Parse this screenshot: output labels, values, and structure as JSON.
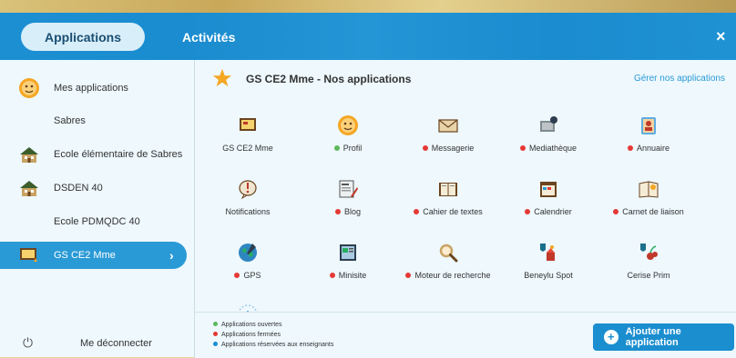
{
  "header": {
    "tab_applications": "Applications",
    "tab_activites": "Activités",
    "close_glyph": "×"
  },
  "sidebar": {
    "items": [
      {
        "label": "Mes applications",
        "icon": "profile-face-icon"
      },
      {
        "label": "Sabres"
      },
      {
        "label": "Ecole élémentaire de Sabres",
        "icon": "school-house-icon"
      },
      {
        "label": "DSDEN 40",
        "icon": "school-house-icon"
      },
      {
        "label": "Ecole PDMQDC 40"
      },
      {
        "label": "GS CE2 Mme",
        "icon": "class-board-icon",
        "active": true,
        "chevron": "›"
      }
    ],
    "logout_label": "Me déconnecter",
    "logout_icon": "power-icon"
  },
  "main": {
    "title": "GS CE2 Mme - Nos applications",
    "manage_link": "Gérer nos applications",
    "apps": [
      {
        "name": "GS CE2 Mme",
        "status": "none",
        "icon": "class-board-icon"
      },
      {
        "name": "Profil",
        "status": "open",
        "icon": "profile-face-icon"
      },
      {
        "name": "Messagerie",
        "status": "closed",
        "icon": "envelope-icon"
      },
      {
        "name": "Mediathèque",
        "status": "closed",
        "icon": "media-library-icon"
      },
      {
        "name": "Annuaire",
        "status": "closed",
        "icon": "directory-icon"
      },
      {
        "name": "Notifications",
        "status": "none",
        "icon": "notification-icon"
      },
      {
        "name": "Blog",
        "status": "closed",
        "icon": "blog-icon"
      },
      {
        "name": "Cahier de textes",
        "status": "closed",
        "icon": "notebook-icon"
      },
      {
        "name": "Calendrier",
        "status": "closed",
        "icon": "calendar-icon"
      },
      {
        "name": "Carnet de liaison",
        "status": "closed",
        "icon": "liaison-book-icon"
      },
      {
        "name": "GPS",
        "status": "closed",
        "icon": "globe-icon"
      },
      {
        "name": "Minisite",
        "status": "closed",
        "icon": "minisite-icon"
      },
      {
        "name": "Moteur de recherche",
        "status": "closed",
        "icon": "search-icon"
      },
      {
        "name": "Beneylu Spot",
        "status": "none",
        "icon": "beneylu-spot-icon"
      },
      {
        "name": "Cerise Prim",
        "status": "none",
        "icon": "cerise-prim-icon"
      }
    ]
  },
  "footer": {
    "legend": [
      {
        "label": "Applications ouvertes",
        "color": "#5cb85c"
      },
      {
        "label": "Applications fermées",
        "color": "#e53935"
      },
      {
        "label": "Applications réservées aux enseignants",
        "color": "#1b8ed0"
      }
    ],
    "add_button": "Ajouter une application",
    "add_plus": "+"
  },
  "colors": {
    "accent": "#1b8ed0",
    "open": "#5cb85c",
    "closed": "#e53935"
  }
}
